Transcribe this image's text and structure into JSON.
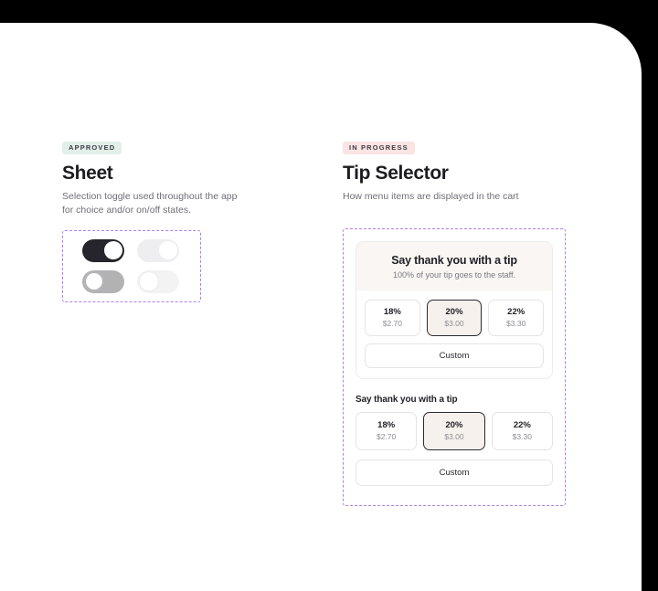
{
  "sections": [
    {
      "badge": "APPROVED",
      "title": "Sheet",
      "description": "Selection toggle used throughout the app for choice and/or on/off states.",
      "toggles": [
        {
          "name": "toggle-on-active",
          "state": "on",
          "variant": "v-dark"
        },
        {
          "name": "toggle-on-disabled",
          "state": "on",
          "variant": "v-faint-on"
        },
        {
          "name": "toggle-off-active",
          "state": "off",
          "variant": "v-gray"
        },
        {
          "name": "toggle-off-disabled",
          "state": "off",
          "variant": "v-faint-off"
        }
      ]
    },
    {
      "badge": "IN PROGRESS",
      "title": "Tip Selector",
      "description": "How menu items are displayed in the cart",
      "card": {
        "heading": "Say thank you with a tip",
        "subheading": "100% of your tip goes to the staff.",
        "options": [
          {
            "percent": "18%",
            "amount": "$2.70",
            "selected": false
          },
          {
            "percent": "20%",
            "amount": "$3.00",
            "selected": true
          },
          {
            "percent": "22%",
            "amount": "$3.30",
            "selected": false
          }
        ],
        "custom_label": "Custom"
      },
      "plain": {
        "heading": "Say thank you with a tip",
        "options": [
          {
            "percent": "18%",
            "amount": "$2.70",
            "selected": false
          },
          {
            "percent": "20%",
            "amount": "$3.00",
            "selected": true
          },
          {
            "percent": "22%",
            "amount": "$3.30",
            "selected": false
          }
        ],
        "custom_label": "Custom"
      }
    }
  ],
  "colors": {
    "badge_approved_bg": "#e2efe9",
    "badge_progress_bg": "#fbe4e4",
    "frame_dashed": "#b07de8",
    "toggle_on": "#25252b",
    "selected_border": "#2b2b30",
    "selected_fill": "#f6f1ec",
    "card_header_bg": "#faf6f3"
  }
}
